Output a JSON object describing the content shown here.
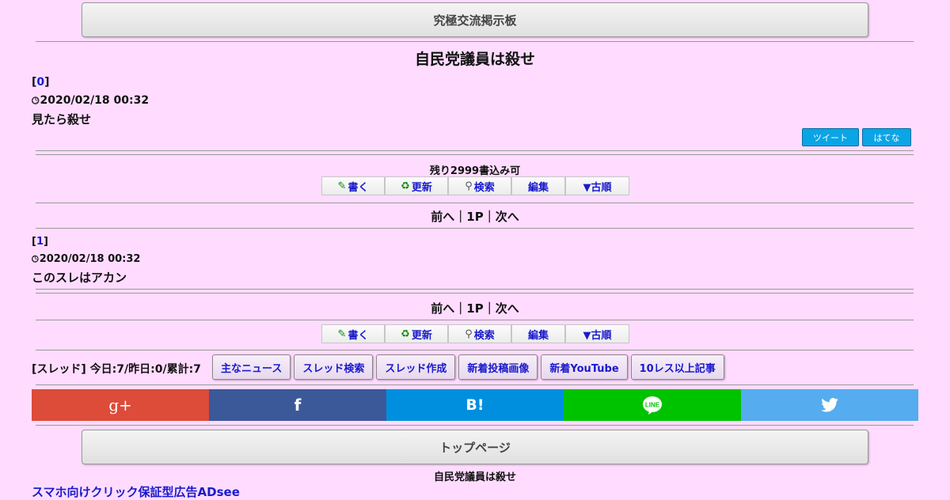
{
  "header": {
    "board_title": "究極交流掲示板"
  },
  "thread": {
    "title": "自民党議員は殺せ",
    "footer_title": "自民党議員は殺せ"
  },
  "post0": {
    "num": "0",
    "date": "2020/02/18 00:32",
    "body": "見たら殺せ"
  },
  "share": {
    "tweet": "ツイート",
    "hatena": "はてな"
  },
  "remaining": "残り2999書込み可",
  "toolbar": {
    "write": "書く",
    "refresh": "更新",
    "search": "検索",
    "edit": "編集",
    "old": "▼古順"
  },
  "pager": {
    "prev": "前へ",
    "page": "1P",
    "next": "次へ",
    "sep": "｜"
  },
  "post1": {
    "num": "1",
    "date": "2020/02/18 00:32",
    "body": "このスレはアカン"
  },
  "stats": "[スレッド] 今日:7/昨日:0/累計:7",
  "nav": [
    "主なニュース",
    "スレッド検索",
    "スレッド作成",
    "新着投稿画像",
    "新着YouTube",
    "10レス以上記事"
  ],
  "top_page": "トップページ",
  "ad_link": "スマホ向けクリック保証型広告ADsee",
  "colors": {
    "google": "#dd4b39",
    "facebook": "#3b5998",
    "hatena": "#008fde",
    "line": "#00c300",
    "twitter": "#55acee"
  }
}
